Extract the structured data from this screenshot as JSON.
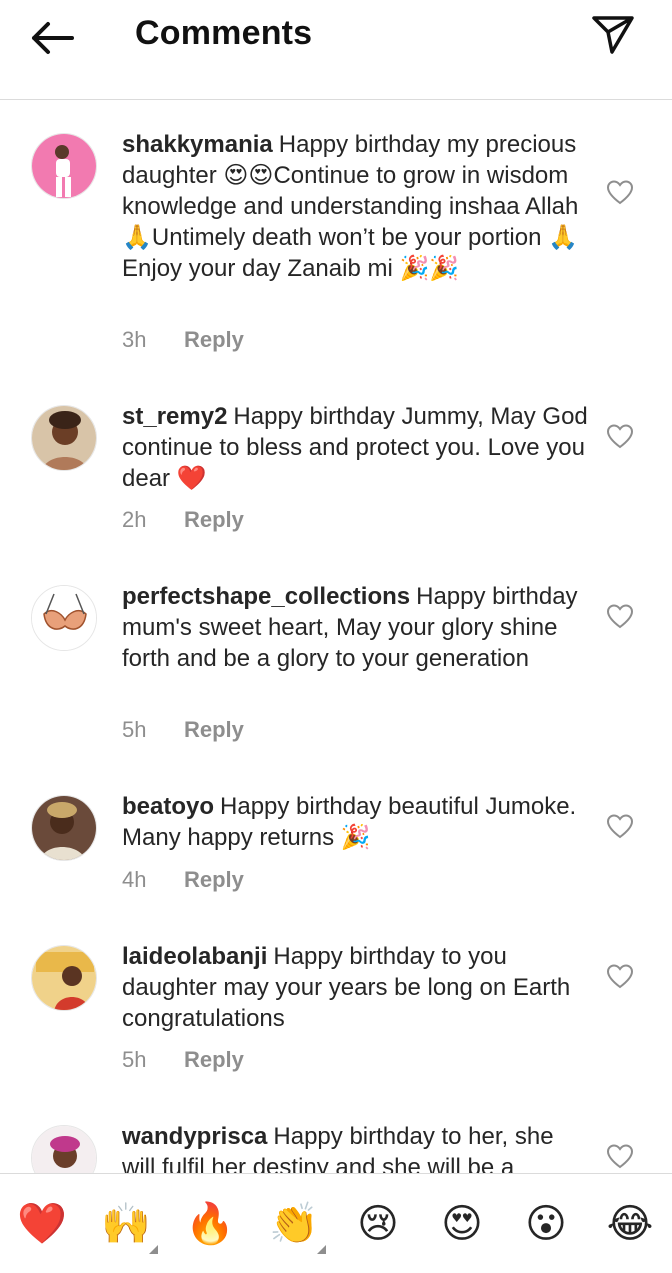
{
  "header": {
    "title": "Comments",
    "back_icon": "arrow-left-icon",
    "send_icon": "paper-plane-icon"
  },
  "comments": [
    {
      "username": "shakkymania",
      "text": "Happy birthday my precious daughter 😍😍Continue to grow in wisdom knowledge and understanding inshaa Allah 🙏Untimely death won’t be your portion 🙏Enjoy your day Zanaib mi 🎉🎉",
      "time": "3h",
      "reply": "Reply"
    },
    {
      "username": "st_remy2",
      "text": "Happy birthday Jummy, May God continue to bless and protect you. Love you dear ❤️",
      "time": "2h",
      "reply": "Reply"
    },
    {
      "username": "perfectshape_collections",
      "text": "Happy birthday mum's sweet heart,  May your glory shine forth and be a glory to your generation",
      "time": "5h",
      "reply": "Reply"
    },
    {
      "username": "beatoyo",
      "text": "Happy birthday beautiful Jumoke. Many happy returns 🎉",
      "time": "4h",
      "reply": "Reply"
    },
    {
      "username": "laideolabanji",
      "text": "Happy birthday to you daughter may your years be long on Earth congratulations",
      "time": "5h",
      "reply": "Reply"
    },
    {
      "username": "wandyprisca",
      "text": "Happy birthday to her, she will fulfil her destiny and she will be a",
      "time": "",
      "reply": ""
    }
  ],
  "emoji_bar": [
    "❤️",
    "🙌",
    "🔥",
    "👏",
    "😢",
    "😍",
    "😮",
    "😂"
  ],
  "colors": {
    "text": "#262626",
    "muted": "#8e8e8e",
    "divider": "#dbdbdb"
  }
}
